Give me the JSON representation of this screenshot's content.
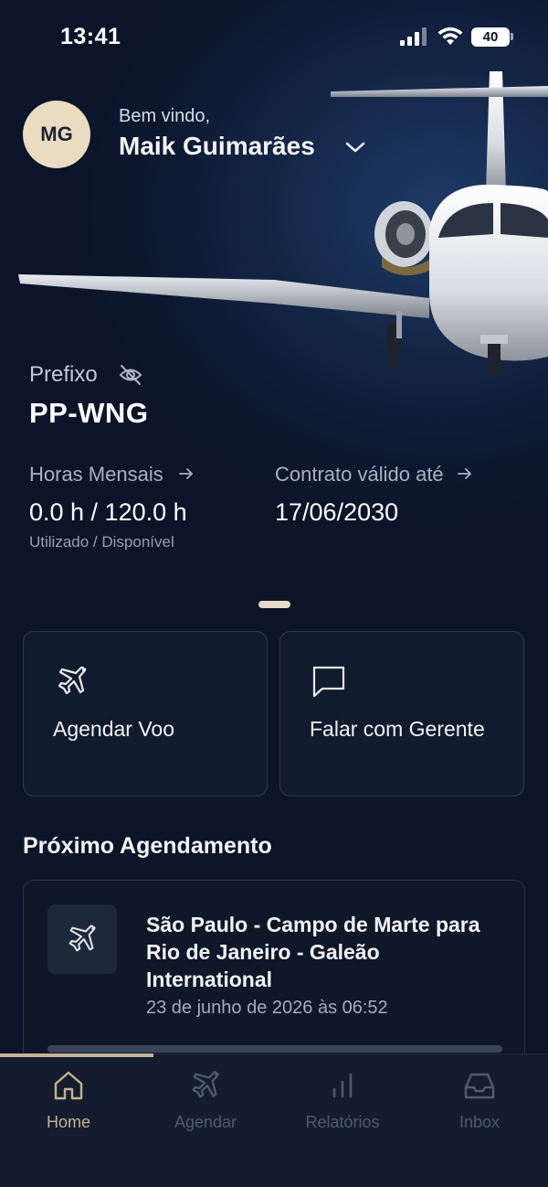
{
  "status_bar": {
    "time": "13:41",
    "battery": "40"
  },
  "header": {
    "avatar_initials": "MG",
    "welcome": "Bem vindo,",
    "user_name": "Maik Guimarães"
  },
  "aircraft": {
    "prefix_label": "Prefixo",
    "prefix_value": "PP-WNG",
    "hours_label": "Horas Mensais",
    "hours_value": "0.0 h / 120.0 h",
    "hours_sub": "Utilizado / Disponível",
    "contract_label": "Contrato válido até",
    "contract_value": "17/06/2030"
  },
  "actions": [
    {
      "label": "Agendar Voo",
      "icon": "plane-icon"
    },
    {
      "label": "Falar com Gerente",
      "icon": "chat-icon"
    }
  ],
  "next_booking": {
    "section_title": "Próximo Agendamento",
    "title": "São Paulo - Campo de Marte para Rio de Janeiro - Galeão International",
    "date": "23 de junho de 2026 às 06:52"
  },
  "tabbar": {
    "active": "Home",
    "items": [
      {
        "label": "Home",
        "icon": "home-icon"
      },
      {
        "label": "Agendar",
        "icon": "plane-icon"
      },
      {
        "label": "Relatórios",
        "icon": "bar-chart-icon"
      },
      {
        "label": "Inbox",
        "icon": "inbox-icon"
      }
    ]
  },
  "colors": {
    "accent": "#c6b28f",
    "background": "#0c1528",
    "card_border": "#2e3a52",
    "inactive_tab": "#4e5a6e"
  }
}
